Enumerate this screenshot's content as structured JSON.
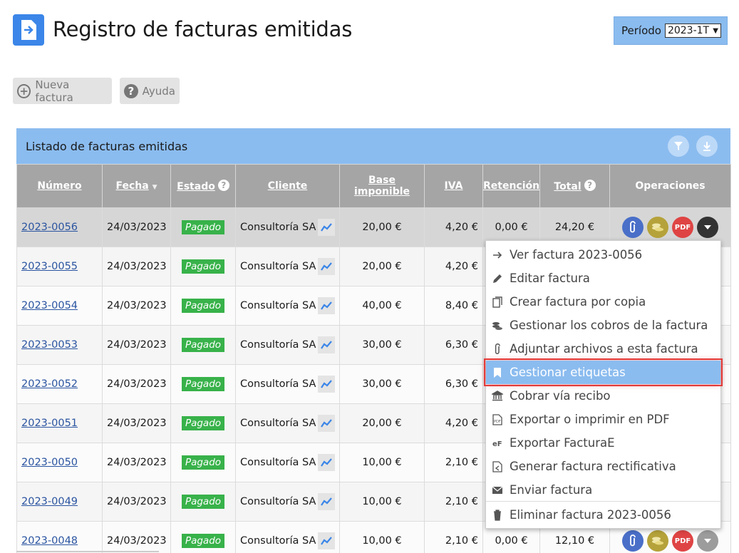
{
  "header": {
    "title": "Registro de facturas emitidas",
    "period_label": "Período",
    "period_value": "2023-1T"
  },
  "toolbar": {
    "new_label": "Nueva factura",
    "help_label": "Ayuda"
  },
  "panel": {
    "title": "Listado de facturas emitidas"
  },
  "table": {
    "columns": [
      "Número",
      "Fecha",
      "Estado",
      "Cliente",
      "Base imponible",
      "IVA",
      "Retención",
      "Total",
      "Operaciones"
    ],
    "rows": [
      {
        "numero": "2023-0056",
        "fecha": "24/03/2023",
        "estado": "Pagado",
        "cliente": "Consultoría SA",
        "base": "20,00 €",
        "iva": "4,20 €",
        "retencion": "0,00 €",
        "total": "24,20 €"
      },
      {
        "numero": "2023-0055",
        "fecha": "24/03/2023",
        "estado": "Pagado",
        "cliente": "Consultoría SA",
        "base": "20,00 €",
        "iva": "4,20 €",
        "retencion": "",
        "total": ""
      },
      {
        "numero": "2023-0054",
        "fecha": "24/03/2023",
        "estado": "Pagado",
        "cliente": "Consultoría SA",
        "base": "40,00 €",
        "iva": "8,40 €",
        "retencion": "",
        "total": ""
      },
      {
        "numero": "2023-0053",
        "fecha": "24/03/2023",
        "estado": "Pagado",
        "cliente": "Consultoría SA",
        "base": "30,00 €",
        "iva": "6,30 €",
        "retencion": "",
        "total": ""
      },
      {
        "numero": "2023-0052",
        "fecha": "24/03/2023",
        "estado": "Pagado",
        "cliente": "Consultoría SA",
        "base": "30,00 €",
        "iva": "6,30 €",
        "retencion": "",
        "total": ""
      },
      {
        "numero": "2023-0051",
        "fecha": "24/03/2023",
        "estado": "Pagado",
        "cliente": "Consultoría SA",
        "base": "20,00 €",
        "iva": "4,20 €",
        "retencion": "",
        "total": ""
      },
      {
        "numero": "2023-0050",
        "fecha": "24/03/2023",
        "estado": "Pagado",
        "cliente": "Consultoría SA",
        "base": "10,00 €",
        "iva": "2,10 €",
        "retencion": "",
        "total": ""
      },
      {
        "numero": "2023-0049",
        "fecha": "24/03/2023",
        "estado": "Pagado",
        "cliente": "Consultoría SA",
        "base": "10,00 €",
        "iva": "2,10 €",
        "retencion": "",
        "total": ""
      },
      {
        "numero": "2023-0048",
        "fecha": "24/03/2023",
        "estado": "Pagado",
        "cliente": "Consultoría SA",
        "base": "10,00 €",
        "iva": "2,10 €",
        "retencion": "0,00 €",
        "total": "12,10 €"
      }
    ]
  },
  "ops_icons": {
    "clip": "paperclip-icon",
    "coins": "coins-icon",
    "pdf": "PDF",
    "more": "chevron-down-icon"
  },
  "menu": {
    "items": [
      {
        "label": "Ver factura 2023-0056",
        "icon": "arrow-right-icon"
      },
      {
        "label": "Editar factura",
        "icon": "pencil-icon"
      },
      {
        "label": "Crear factura por copia",
        "icon": "copy-icon"
      },
      {
        "label": "Gestionar los cobros de la factura",
        "icon": "coins-icon"
      },
      {
        "label": "Adjuntar archivos a esta factura",
        "icon": "paperclip-icon"
      },
      {
        "label": "Gestionar etiquetas",
        "icon": "bookmark-icon"
      },
      {
        "label": "Cobrar vía recibo",
        "icon": "bank-icon"
      },
      {
        "label": "Exportar o imprimir en PDF",
        "icon": "pdf-icon"
      },
      {
        "label": "Exportar FacturaE",
        "icon": "facturae-icon"
      },
      {
        "label": "Generar factura rectificativa",
        "icon": "rectify-icon"
      },
      {
        "label": "Enviar factura",
        "icon": "envelope-icon"
      },
      {
        "label": "Eliminar factura 2023-0056",
        "icon": "trash-icon"
      }
    ]
  },
  "colors": {
    "accent": "#8bbcef",
    "header_gray": "#a5a5a5",
    "paid": "#38b24a",
    "link": "#2a54a0",
    "highlight_outline": "#e23b3b"
  }
}
